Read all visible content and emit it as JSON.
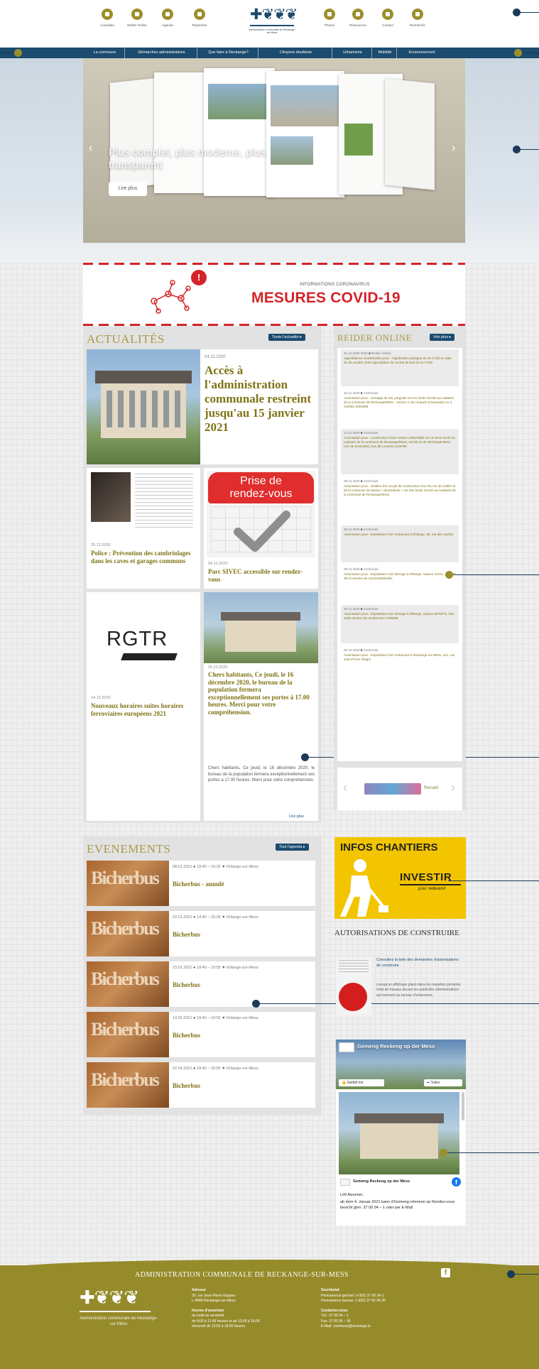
{
  "header": {
    "icons": [
      {
        "label": "Actualités",
        "icon": "news-icon"
      },
      {
        "label": "Reider Online",
        "icon": "reider-icon"
      },
      {
        "label": "Agenda",
        "icon": "calendar-icon"
      },
      {
        "label": "Répertoire",
        "icon": "directory-icon"
      },
      {
        "label": "Photos",
        "icon": "photo-icon"
      },
      {
        "label": "Ressources",
        "icon": "resources-icon"
      },
      {
        "label": "Contact",
        "icon": "contact-icon"
      },
      {
        "label": "Recherche",
        "icon": "search-icon"
      }
    ],
    "logo_caption": "Administration communale de Reckange-sur-Mess"
  },
  "nav": {
    "items": [
      "La commune",
      "Démarches administratives",
      "Que faire à Reckange?",
      "Citoyens étudiants",
      "Urbanisme",
      "Mobilité",
      "Environnement"
    ]
  },
  "hero": {
    "title": "Plus complet, plus moderne, plus transparent",
    "cta": "Lire plus"
  },
  "covid": {
    "kicker": "INFORMATIONS CORONAVIRUS",
    "title": "MESURES COVID-19"
  },
  "news": {
    "heading": "ACTUALITÉS",
    "all_button": "Toute l'actualité ▸",
    "featured": {
      "date": "04.11.2020",
      "title": "Accès à l'administration communale restreint jusqu'au 15 janvier 2021"
    },
    "card1": {
      "date": "25.12.2020",
      "title": "Police : Prévention des cambriolages dans les caves et garages communs"
    },
    "card2": {
      "date": "04.12.2020",
      "title": "Parc SIVEC accessible sur rendez-vous",
      "badge_line1": "Prise de",
      "badge_line2": "rendez-vous"
    },
    "card3": {
      "date": "14.12.2020",
      "title": "Nouveaux horaires suites horaires ferroviaires européens 2021",
      "logo": "RGTR"
    },
    "card4": {
      "date": "15.12.2020",
      "title": "Chers habitants, Ce jeudi, le 16 décembre 2020, le bureau de la population fermera exceptionnellement ses portes à 17.00 heures. Merci pour votre compréhension.",
      "body": "Chers habitants, Ce jeudi, le 16 décembre 2020, le bureau de la population fermera exceptionnellement ses portes à 17.00 heures. Merci pour votre compréhension.",
      "more": "Lire plus"
    }
  },
  "reider": {
    "heading": "REIDER ONLINE",
    "all_button": "Voir plus ▸",
    "items": [
      {
        "date": "01.12.2020 2020",
        "cat": "Reider Online",
        "title": "Approbations ministérielles pour : Adjudication publique du lot n°220 en date du 26 octobre 2020 Approbation du contrat de bail du lot n°226"
      },
      {
        "date": "15.12.2020",
        "cat": "Commodo",
        "title": "Autorisation pour : montage de toit, pergolas sur les fonds inscrits au cadastre de la commune de Reckange/Mess : section C de Limpach (Chaussée) no 4 mobiles 2052598"
      },
      {
        "date": "14.12.2020",
        "cat": "Commodo",
        "title": "Autorisation pour : construction d'une maison unifamiliale sur un fond inscrit au cadastre de la commune de Reckange/Mess, section D de Reckange-Mess (rue de la Montée), lieu dit Lovacks 2148798"
      },
      {
        "date": "09.12.2020",
        "cat": "Commodo",
        "title": "Autorisation pour : installer d'un projet de construction d'un R1 rue de Cattler et de la commune de Mamer « Buschbeek » sur des fonds inscrits au cadastre de la commune de Reckange/Mess"
      },
      {
        "date": "09.12.2020",
        "cat": "Commodo",
        "title": "Autorisation pour : Exploitation d'un restaurant à Ehlange, 35, rue des Jardins"
      },
      {
        "date": "09.12.2020",
        "cat": "Commodo",
        "title": "Autorisation pour : Exploitation d'un élevage à Ehlange, maison SIVCL, KDL 30 '90 et années de commodo/Mobile"
      },
      {
        "date": "06.12.2020",
        "cat": "Commodo",
        "title": "Autorisation pour : Exploitation d'un élevage à Ehlange, maison 5570372, KDL 1200 années de construction 2708098"
      },
      {
        "date": "06.12.2020",
        "cat": "Commodo",
        "title": "Autorisation pour : Exploitation d'un restaurant à Reckange-sur-Mess, 211, rue Jean-Pierre Allegre"
      }
    ],
    "partner": "Recueil"
  },
  "events": {
    "heading": "EVENEMENTS",
    "all_button": "Tout l'agenda ▸",
    "items": [
      {
        "date": "08.01.2021",
        "time": "19:40 – 19:35",
        "place": "Ehlange-sur-Mess",
        "title": "Bicherbus - annulé"
      },
      {
        "date": "20.01.2021",
        "time": "14:40 – 15:35",
        "place": "Ehlange-sur-Mess",
        "title": "Bicherbus"
      },
      {
        "date": "23.01.2021",
        "time": "19:40 – 19:55",
        "place": "Ehlange-sur-Mess",
        "title": "Bicherbus"
      },
      {
        "date": "13.02.2021",
        "time": "19:40 – 19:55",
        "place": "Ehlange-sur-Mess",
        "title": "Bicherbus"
      },
      {
        "date": "22.04.2021",
        "time": "19:40 – 15:55",
        "place": "Ehlange-sur-Mess",
        "title": "Bicherbus"
      }
    ],
    "logo_text": "Bicherbus"
  },
  "chantiers": {
    "title": "INFOS CHANTIERS",
    "invest": "INVESTIR",
    "invest_sub": "pour redevenir"
  },
  "autorisations": {
    "title": "AUTORISATIONS DE CONSTRUIRE",
    "link": "Consultez la liste des demandes d'autorisations de construire",
    "text": "Lorsqu'un affichage placé dans les requêtes présente l'état de travaux devant les publicités administratives qui tournent au bureau d'urbanisme."
  },
  "facebook": {
    "page_name": "Gemeng Reckeng op der Mess",
    "like": "Gefällt mir",
    "share": "Teilen",
    "post_author": "Gemeng Reckeng op der Mess",
    "post_title": "Léif Awunner,",
    "post_text": "ab dem 4. Januar 2021 kann d'Gemeng nëmmen op Rendez-vous besicht ginn. 37 00 34 – 1 oder per E-Mail"
  },
  "footer": {
    "title": "ADMINISTRATION COMMUNALE DE RECKANGE-SUR-MESS",
    "brand": "Administration communale de Reckange-sur-Mess",
    "col1_title": "Adresse",
    "col1_lines": [
      "30, rue Jean-Pierre Koppes",
      "L-4940 Reckange-sur-Mess"
    ],
    "col1b_title": "Heures d'ouverture",
    "col1b_lines": [
      "du lundi au vendredi",
      "de 8:00 à 11:45 heures et de 13:00 à 16:00",
      "mercredi de 13:00 à 18:00 heures"
    ],
    "col2_title": "Secrétariat",
    "col2_lines": [
      "Permanence guichet: (+352) 37 00 34-1",
      "Permanence bureau: (+352) 37 00 34-25"
    ],
    "col2b_title": "Contactez-nous",
    "col2b_lines": [
      "Tél.: 37 00 34 – 1",
      "Fax: 37 83 36 – 36",
      "E-Mail: commune@reckange.lu"
    ]
  },
  "colors": {
    "navy": "#1b4b6e",
    "olive": "#968b2b",
    "covid_red": "#d42428",
    "chantiers_yellow": "#f2c500"
  }
}
